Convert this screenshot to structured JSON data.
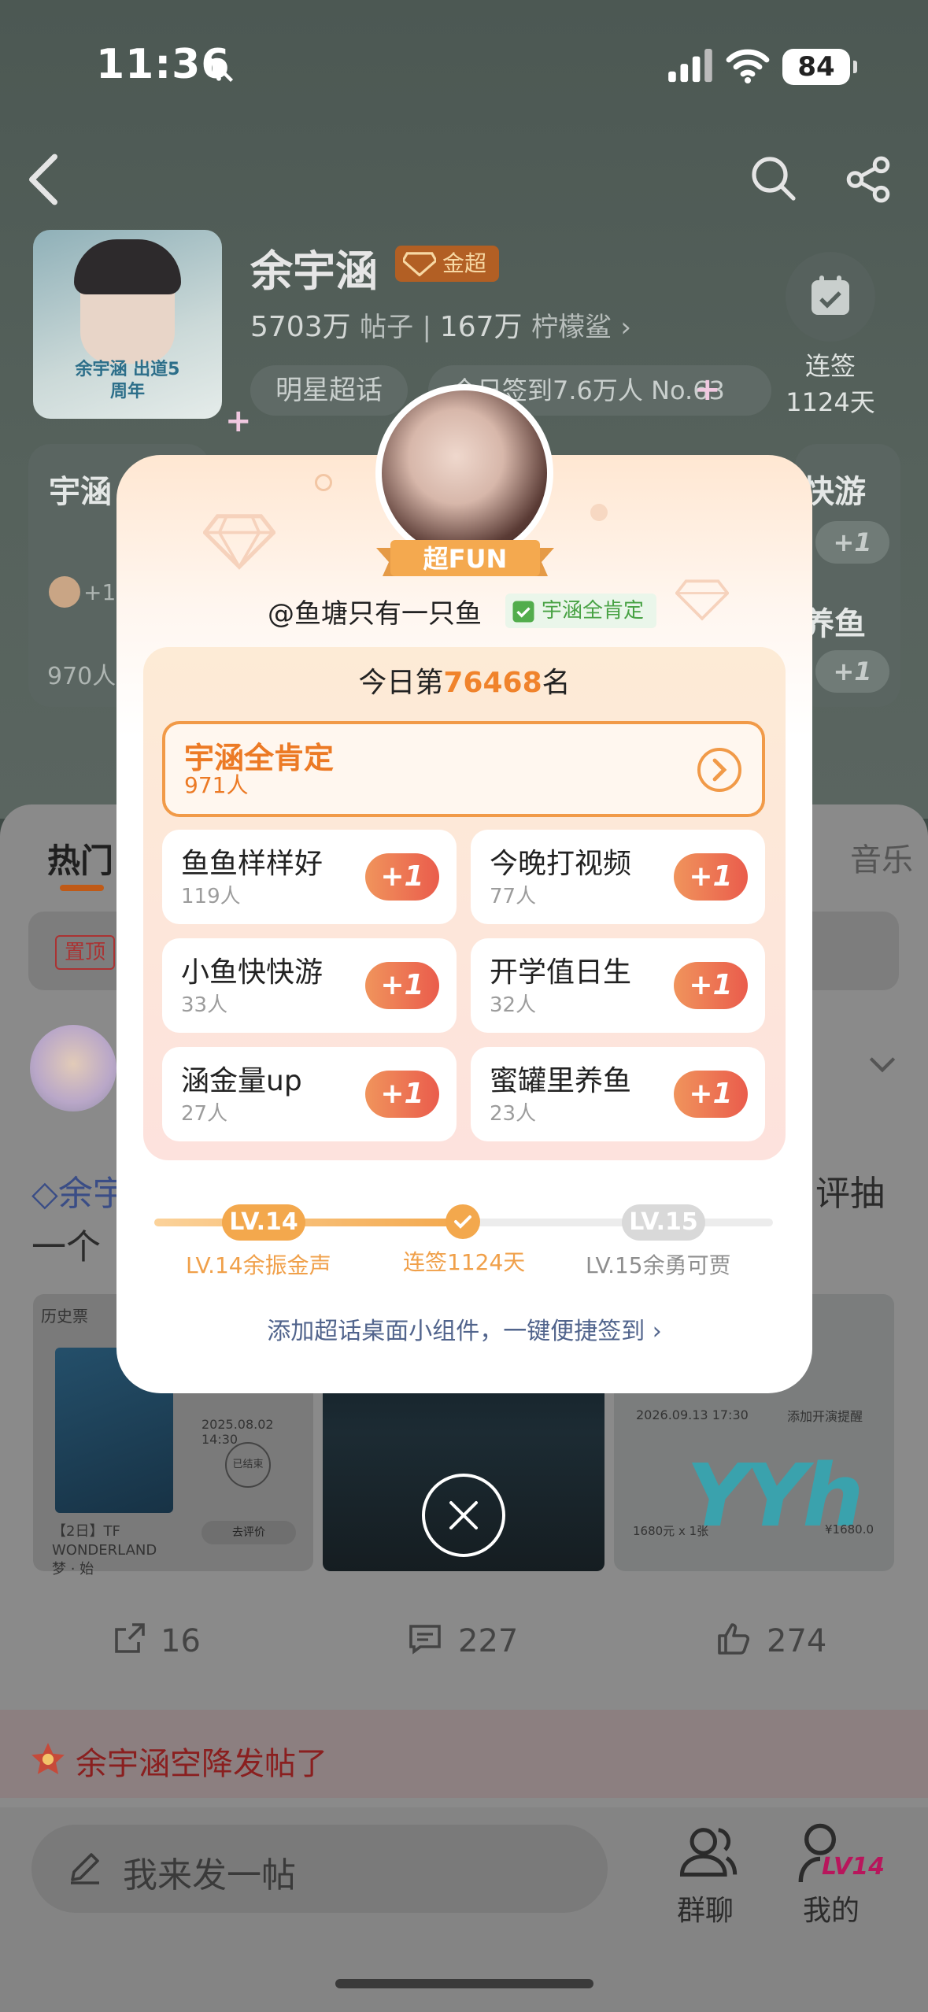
{
  "status_bar": {
    "time": "11:36",
    "battery": "84"
  },
  "topic": {
    "name": "余宇涵",
    "badge": "金超",
    "posts_count": "5703万",
    "posts_label": "帖子",
    "fans_count": "167万",
    "fans_label": "柠檬鲨",
    "category_pill": "明星超话",
    "checkin_pill": "今日签到7.6万人 No.63",
    "cover_caption": "余宇涵 出道5周年",
    "streak_line1": "连签",
    "streak_line2": "1124天"
  },
  "bg_cards": {
    "left_title": "宇涵",
    "left_plus": "+1",
    "left_count": "970人",
    "right_title1": "快游",
    "right_title2": "养鱼",
    "right_plus": "+1"
  },
  "feed": {
    "tab_hot": "热门",
    "tab_music": "音乐",
    "pin_label": "置顶",
    "post_title_part1": "余宇",
    "post_title_part2": "一个",
    "post_title_part3": "评抽",
    "img1_header": "历史票",
    "img1_date": "2025.08.02 14:30",
    "img1_status": "已结束",
    "img1_caption": "【2日】TF WONDERLAND梦 · 始",
    "img1_rate": "去评价",
    "img3_time": "2026.09.13 17:30",
    "img3_remind": "添加开演提醒",
    "img3_price": "1680元 x 1张",
    "img3_total": "¥1680.0",
    "img3_yy": "YYh",
    "shares": "16",
    "comments": "227",
    "likes": "274",
    "banner_text": "余宇涵空降发帖了"
  },
  "bottom_bar": {
    "composer_placeholder": "我来发一帖",
    "group_chat": "群聊",
    "mine": "我的",
    "mine_level": "LV14"
  },
  "modal": {
    "fun_badge": "超FUN",
    "handle": "@鱼塘只有一只鱼",
    "verify_tag": "宇涵全肯定",
    "rank_prefix": "今日第",
    "rank_number": "76468",
    "rank_suffix": "名",
    "main_option": {
      "title": "宇涵全肯定",
      "count": "971人"
    },
    "options": [
      {
        "title": "鱼鱼样样好",
        "count": "119人",
        "button": "+1"
      },
      {
        "title": "今晚打视频",
        "count": "77人",
        "button": "+1"
      },
      {
        "title": "小鱼快快游",
        "count": "33人",
        "button": "+1"
      },
      {
        "title": "开学值日生",
        "count": "32人",
        "button": "+1"
      },
      {
        "title": "涵金量up",
        "count": "27人",
        "button": "+1"
      },
      {
        "title": "蜜罐里养鱼",
        "count": "23人",
        "button": "+1"
      }
    ],
    "level_current": "LV.14",
    "level_next": "LV.15",
    "level_current_label": "LV.14余振金声",
    "streak_label": "连签1124天",
    "level_next_label": "LV.15余勇可贾",
    "level_progress": 0.5,
    "widget_link": "添加超话桌面小组件，一键便捷签到"
  },
  "colors": {
    "accent_orange": "#f0832c",
    "plus_gradient_start": "#f0945c",
    "plus_gradient_end": "#ea5c4c"
  }
}
